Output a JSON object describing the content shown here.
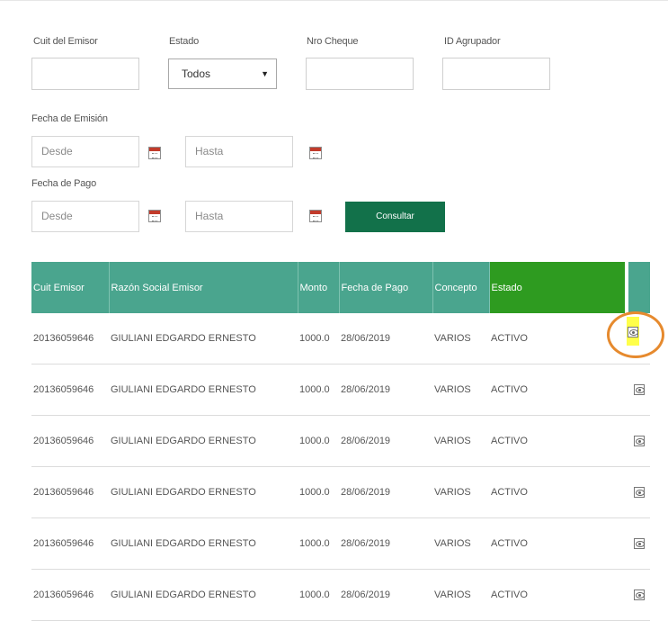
{
  "filters": {
    "cuit_label": "Cuit del Emisor",
    "estado_label": "Estado",
    "estado_value": "Todos",
    "cheque_label": "Nro Cheque",
    "agrupador_label": "ID Agrupador",
    "fecha_emision_label": "Fecha de Emisión",
    "fecha_pago_label": "Fecha de Pago",
    "desde_placeholder": "Desde",
    "hasta_placeholder": "Hasta",
    "consultar_label": "Consultar"
  },
  "table": {
    "headers": [
      "Cuit Emisor",
      "Razón Social Emisor",
      "Monto",
      "Fecha de Pago",
      "Concepto",
      "Estado"
    ],
    "rows": [
      [
        "20136059646",
        "GIULIANI EDGARDO ERNESTO",
        "1000.0",
        "28/06/2019",
        "VARIOS",
        "ACTIVO"
      ],
      [
        "20136059646",
        "GIULIANI EDGARDO ERNESTO",
        "1000.0",
        "28/06/2019",
        "VARIOS",
        "ACTIVO"
      ],
      [
        "20136059646",
        "GIULIANI EDGARDO ERNESTO",
        "1000.0",
        "28/06/2019",
        "VARIOS",
        "ACTIVO"
      ],
      [
        "20136059646",
        "GIULIANI EDGARDO ERNESTO",
        "1000.0",
        "28/06/2019",
        "VARIOS",
        "ACTIVO"
      ],
      [
        "20136059646",
        "GIULIANI EDGARDO ERNESTO",
        "1000.0",
        "28/06/2019",
        "VARIOS",
        "ACTIVO"
      ],
      [
        "20136059646",
        "GIULIANI EDGARDO ERNESTO",
        "1000.0",
        "28/06/2019",
        "VARIOS",
        "ACTIVO"
      ]
    ],
    "action_icon": "eye-icon"
  },
  "colors": {
    "header_bg": "#4aa58e",
    "estado_header_bg": "#2e9b20",
    "button_bg": "#12714a",
    "highlight": "#ffff4a",
    "ring": "#e68a2e"
  }
}
